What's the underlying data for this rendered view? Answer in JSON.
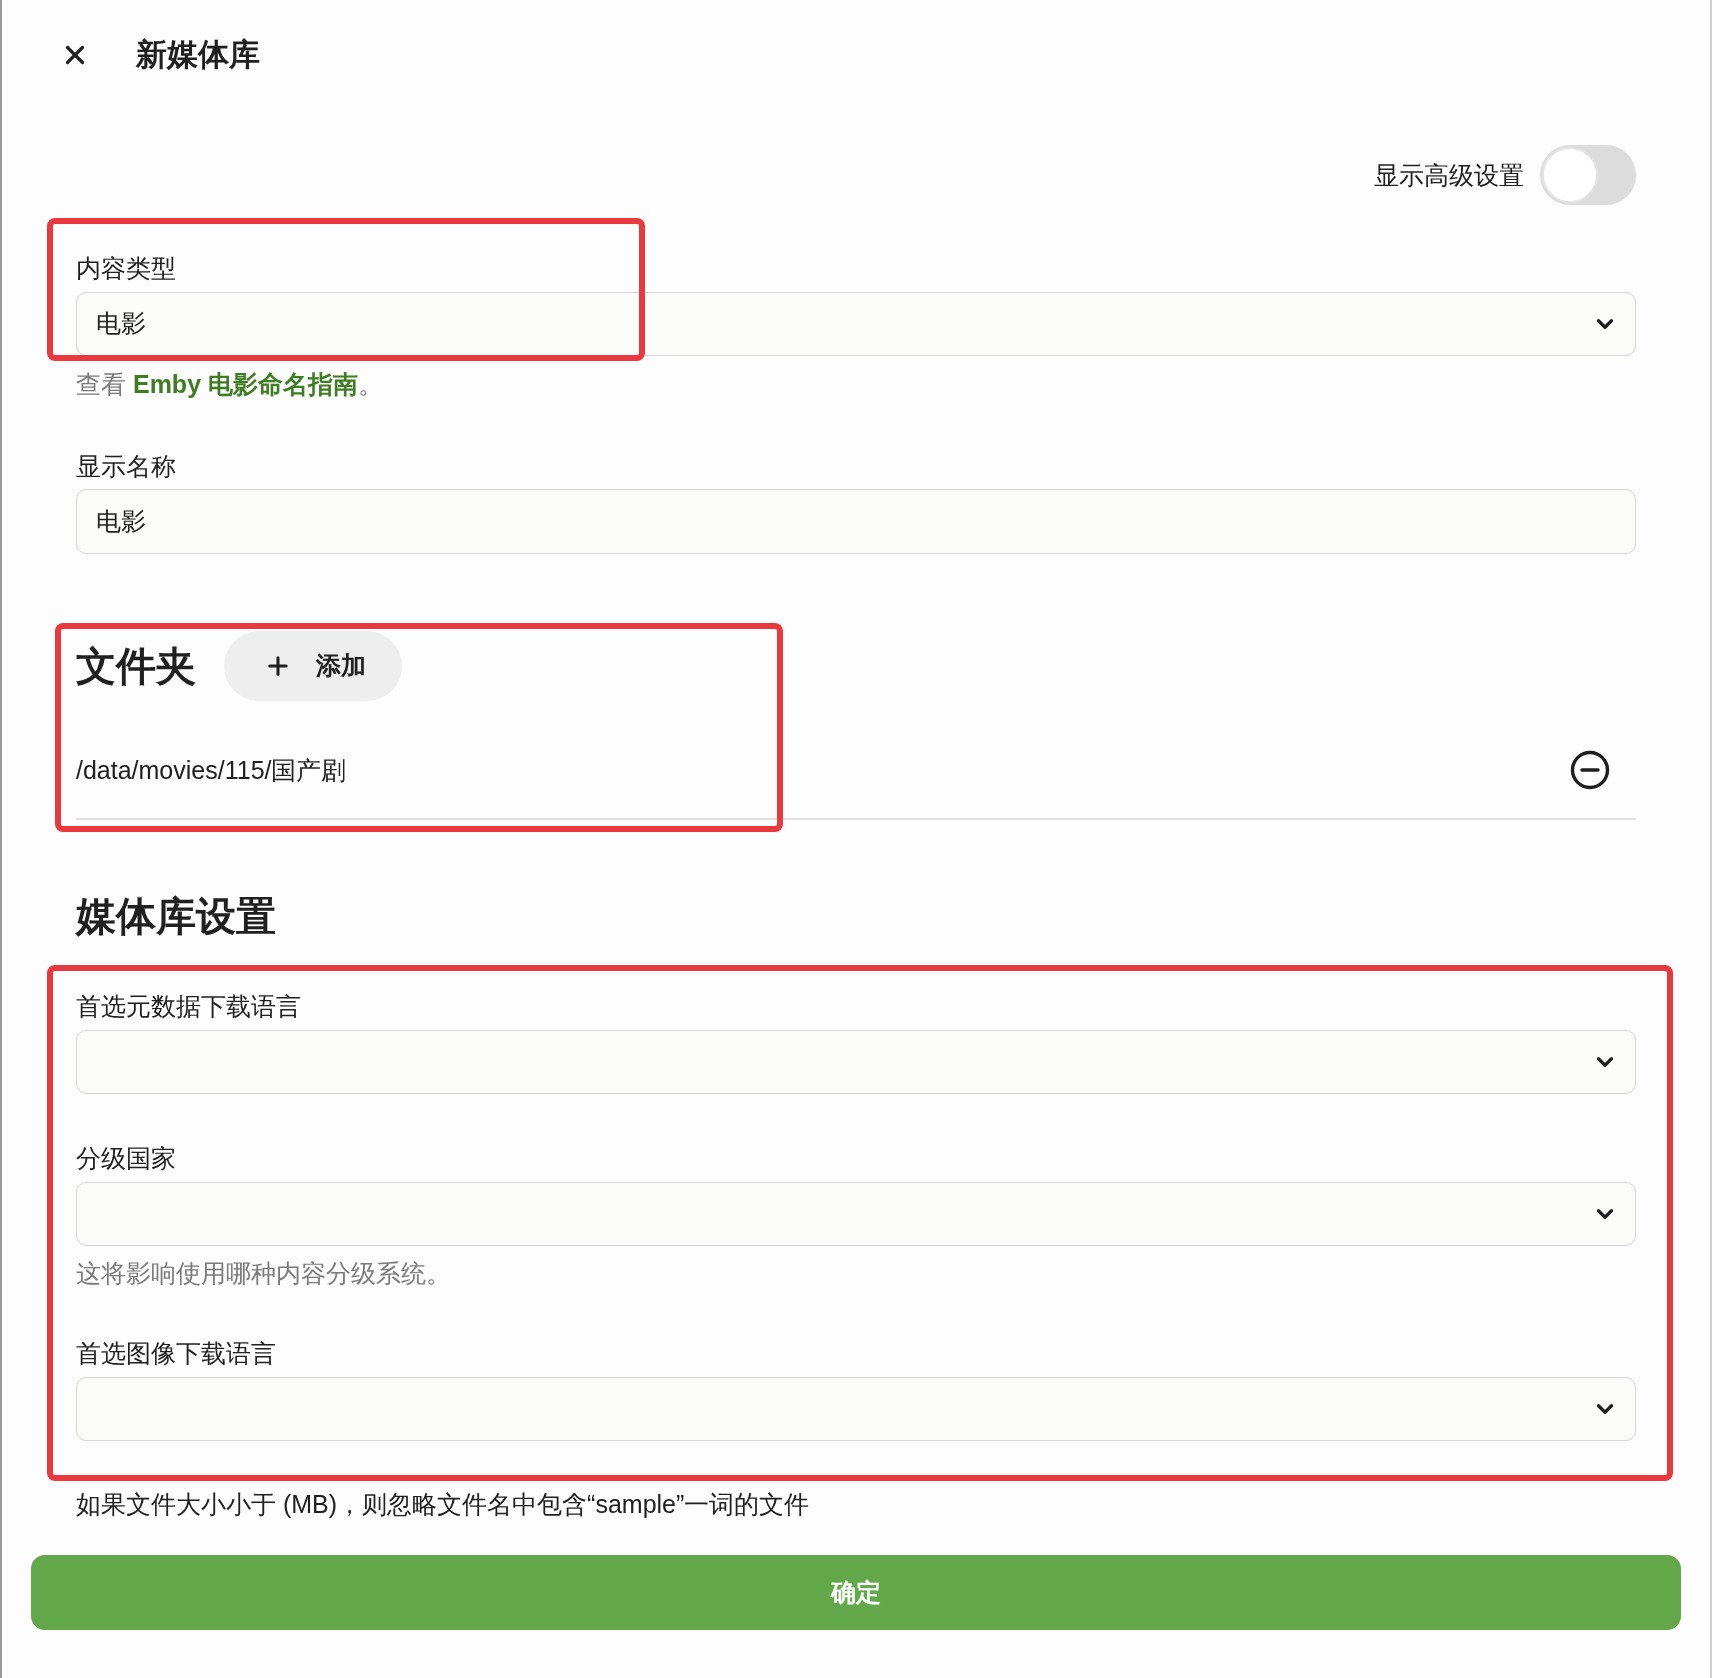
{
  "dialog": {
    "title": "新媒体库"
  },
  "advanced_toggle": {
    "label": "显示高级设置",
    "on": false
  },
  "content_type": {
    "label": "内容类型",
    "value": "电影",
    "highlighted": true,
    "hint": {
      "prefix": "查看 ",
      "link": "Emby 电影命名指南",
      "suffix": "。"
    }
  },
  "display_name": {
    "label": "显示名称",
    "value": "电影"
  },
  "folders": {
    "title": "文件夹",
    "add_button": "添加",
    "highlighted": true,
    "items": [
      {
        "path": "/data/movies/115/国产剧"
      }
    ]
  },
  "library_settings": {
    "title": "媒体库设置",
    "highlighted": true,
    "fields": [
      {
        "label": "首选元数据下载语言"
      },
      {
        "label": "分级国家",
        "hint": "这将影响使用哪种内容分级系统。"
      },
      {
        "label": "首选图像下载语言"
      }
    ]
  },
  "note": "如果文件大小小于 (MB)，则忽略文件名中包含“sample”一词的文件",
  "confirm_button": "确定"
}
